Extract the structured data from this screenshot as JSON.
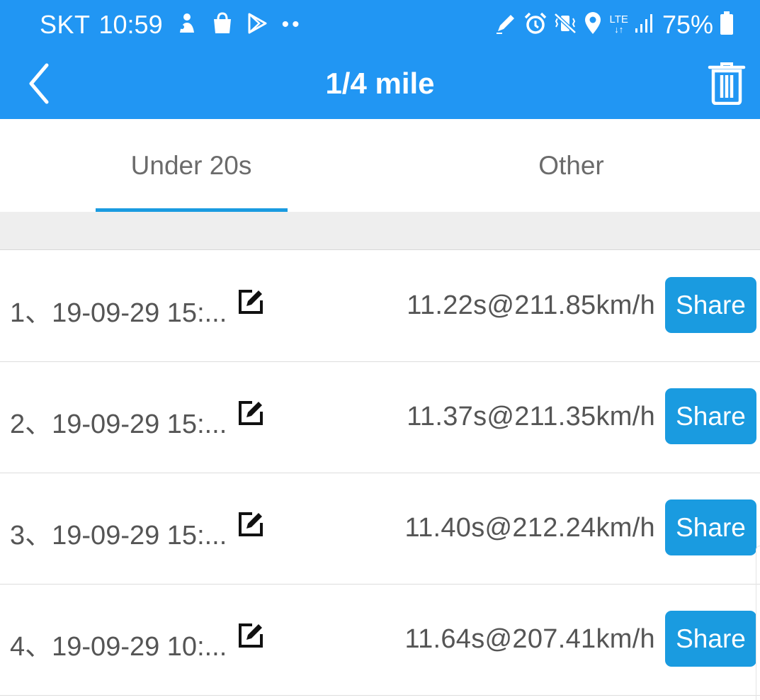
{
  "status_bar": {
    "carrier": "SKT",
    "time": "10:59",
    "network": "LTE",
    "battery_pct": "75%"
  },
  "app_bar": {
    "title": "1/4 mile",
    "back_icon": "chevron-left-icon",
    "delete_icon": "trash-icon"
  },
  "tabs": [
    {
      "label": "Under 20s",
      "active": true
    },
    {
      "label": "Other",
      "active": false
    }
  ],
  "records": [
    {
      "label": "1、19-09-29 15:...",
      "result": "11.22s@211.85km/h",
      "share_label": "Share"
    },
    {
      "label": "2、19-09-29 15:...",
      "result": "11.37s@211.35km/h",
      "share_label": "Share"
    },
    {
      "label": "3、19-09-29 15:...",
      "result": "11.40s@212.24km/h",
      "share_label": "Share"
    },
    {
      "label": "4、19-09-29 10:...",
      "result": "11.64s@207.41km/h",
      "share_label": "Share"
    }
  ],
  "colors": {
    "primary": "#2196F3",
    "accent": "#1a9be0",
    "text": "#555555"
  }
}
